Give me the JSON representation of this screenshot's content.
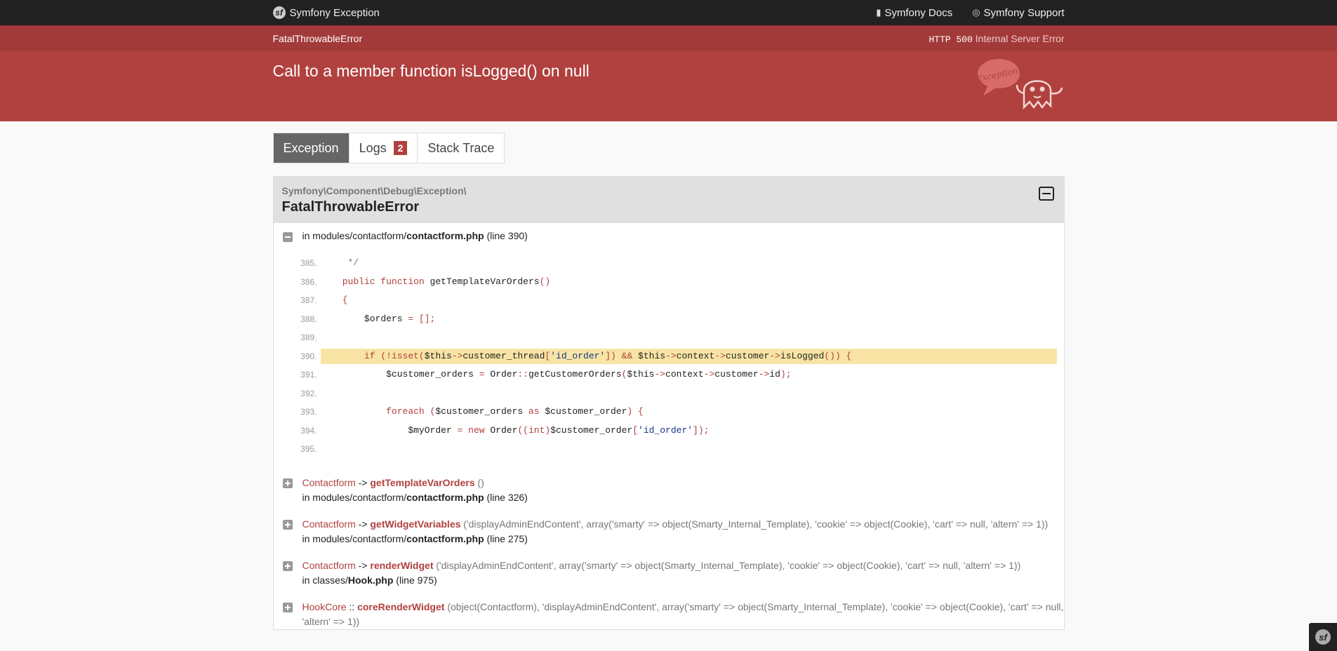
{
  "topbar": {
    "brand": "Symfony Exception",
    "docs_link": "Symfony Docs",
    "support_link": "Symfony Support"
  },
  "status": {
    "exception_class": "FatalThrowableError",
    "http_code": "HTTP 500",
    "http_text": "Internal Server Error"
  },
  "header": {
    "message": "Call to a member function isLogged() on null",
    "mascot_text": "Exception!"
  },
  "tabs": [
    {
      "label": "Exception"
    },
    {
      "label": "Logs",
      "badge": "2"
    },
    {
      "label": "Stack Trace"
    }
  ],
  "panel": {
    "namespace": "Symfony\\Component\\Debug\\Exception\\",
    "classname": "FatalThrowableError"
  },
  "first_frame": {
    "in": "in modules/contactform/",
    "file": "contactform.php",
    "line": "(line 390)"
  },
  "code_lines": [
    {
      "num": "385."
    },
    {
      "num": "386."
    },
    {
      "num": "387."
    },
    {
      "num": "388."
    },
    {
      "num": "389."
    },
    {
      "num": "390."
    },
    {
      "num": "391."
    },
    {
      "num": "392."
    },
    {
      "num": "393."
    },
    {
      "num": "394."
    },
    {
      "num": "395."
    }
  ],
  "code_src": {
    "l385": "     */",
    "l386a": "    ",
    "l386kw": "public function",
    "l386b": " getTemplateVarOrders",
    "l386c": "()",
    "l387": "    {",
    "l388a": "        $orders ",
    "l388b": "= [];",
    "l390a": "        ",
    "l390kw": "if (!isset(",
    "l390b": "$this",
    "l390c": "->",
    "l390d": "customer_thread",
    "l390e": "[",
    "l390s": "'id_order'",
    "l390f": "]) && ",
    "l390g": "$this",
    "l390h": "->",
    "l390i": "context",
    "l390j": "->",
    "l390k": "customer",
    "l390l": "->",
    "l390m": "isLogged",
    "l390n": "()) {",
    "l391a": "            $customer_orders ",
    "l391b": "=",
    "l391c": " Order",
    "l391d": "::",
    "l391e": "getCustomerOrders",
    "l391f": "(",
    "l391g": "$this",
    "l391h": "->",
    "l391i": "context",
    "l391j": "->",
    "l391k": "customer",
    "l391l": "->",
    "l391m": "id",
    "l391n": ");",
    "l393a": "            ",
    "l393kw": "foreach",
    "l393b": " (",
    "l393c": "$customer_orders ",
    "l393d": "as",
    "l393e": " $customer_order",
    "l393f": ") {",
    "l394a": "                $myOrder ",
    "l394b": "= new",
    "l394c": " Order",
    "l394d": "((int)",
    "l394e": "$customer_order",
    "l394f": "[",
    "l394s": "'id_order'",
    "l394g": "]);"
  },
  "frames": [
    {
      "class": "Contactform",
      "op": "->",
      "func": "getTemplateVarOrders",
      "args": "()",
      "in": "in modules/contactform/",
      "file": "contactform.php",
      "line": "(line 326)"
    },
    {
      "class": "Contactform",
      "op": "->",
      "func": "getWidgetVariables",
      "args": "('displayAdminEndContent', array('smarty' => object(Smarty_Internal_Template), 'cookie' => object(Cookie), 'cart' => null, 'altern' => 1))",
      "in": "in modules/contactform/",
      "file": "contactform.php",
      "line": "(line 275)"
    },
    {
      "class": "Contactform",
      "op": "->",
      "func": "renderWidget",
      "args": "('displayAdminEndContent', array('smarty' => object(Smarty_Internal_Template), 'cookie' => object(Cookie), 'cart' => null, 'altern' => 1))",
      "in": "in classes/",
      "file": "Hook.php",
      "line": "(line 975)"
    },
    {
      "class": "HookCore",
      "op": "::",
      "func": "coreRenderWidget",
      "args": "(object(Contactform), 'displayAdminEndContent', array('smarty' => object(Smarty_Internal_Template), 'cookie' => object(Cookie), 'cart' => null, 'altern' => 1))"
    }
  ]
}
